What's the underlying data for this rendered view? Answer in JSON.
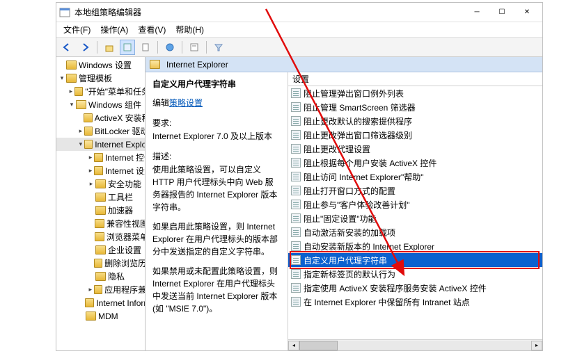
{
  "window": {
    "title": "本地组策略编辑器"
  },
  "menus": [
    "文件(F)",
    "操作(A)",
    "查看(V)",
    "帮助(H)"
  ],
  "tree": [
    {
      "label": "Windows 设置",
      "depth": 0,
      "exp": ""
    },
    {
      "label": "管理模板",
      "depth": 0,
      "exp": "▾"
    },
    {
      "label": "\"开始\"菜单和任务栏",
      "depth": 1,
      "exp": "▸"
    },
    {
      "label": "Windows 组件",
      "depth": 1,
      "exp": "▾",
      "open": true
    },
    {
      "label": "ActiveX 安装程序",
      "depth": 2,
      "exp": ""
    },
    {
      "label": "BitLocker 驱动器",
      "depth": 2,
      "exp": "▸"
    },
    {
      "label": "Internet Explorer",
      "depth": 2,
      "exp": "▾",
      "sel": true,
      "open": true
    },
    {
      "label": "Internet 控件",
      "depth": 3,
      "exp": "▸"
    },
    {
      "label": "Internet 设置",
      "depth": 3,
      "exp": "▸"
    },
    {
      "label": "安全功能",
      "depth": 3,
      "exp": "▸"
    },
    {
      "label": "工具栏",
      "depth": 3,
      "exp": ""
    },
    {
      "label": "加速器",
      "depth": 3,
      "exp": ""
    },
    {
      "label": "兼容性视图",
      "depth": 3,
      "exp": ""
    },
    {
      "label": "浏览器菜单",
      "depth": 3,
      "exp": ""
    },
    {
      "label": "企业设置",
      "depth": 3,
      "exp": ""
    },
    {
      "label": "删除浏览历史",
      "depth": 3,
      "exp": ""
    },
    {
      "label": "隐私",
      "depth": 3,
      "exp": ""
    },
    {
      "label": "应用程序兼容",
      "depth": 3,
      "exp": "▸"
    },
    {
      "label": "Internet Inform",
      "depth": 2,
      "exp": ""
    },
    {
      "label": "MDM",
      "depth": 2,
      "exp": ""
    }
  ],
  "header": {
    "title": "Internet Explorer",
    "col": "设置"
  },
  "details": {
    "title": "自定义用户代理字符串",
    "link_prefix": "编辑",
    "link": "策略设置",
    "req_label": "要求:",
    "req": "Internet Explorer 7.0 及以上版本",
    "desc_label": "描述:",
    "p1": "使用此策略设置，可以自定义 HTTP 用户代理标头中向 Web 服务器报告的 Internet Explorer 版本字符串。",
    "p2": "如果启用此策略设置，则 Internet Explorer 在用户代理标头的版本部分中发送指定的自定义字符串。",
    "p3": "如果禁用或未配置此策略设置，则 Internet Explorer 在用户代理标头中发送当前 Internet Explorer 版本(如 \"MSIE 7.0\")。"
  },
  "settings": [
    "阻止管理弹出窗口例外列表",
    "阻止管理 SmartScreen 筛选器",
    "阻止更改默认的搜索提供程序",
    "阻止更改弹出窗口筛选器级别",
    "阻止更改代理设置",
    "阻止根据每个用户安装 ActiveX 控件",
    "阻止访问 Internet Explorer\"帮助\"",
    "阻止打开窗口方式的配置",
    "阻止参与\"客户体验改善计划\"",
    "阻止\"固定设置\"功能",
    "自动激活新安装的加载项",
    "自动安装新版本的 Internet Explorer",
    "自定义用户代理字符串",
    "指定新标签页的默认行为",
    "指定使用 ActiveX 安装程序服务安装 ActiveX 控件",
    "在 Internet Explorer 中保留所有 Intranet 站点"
  ],
  "selected_index": 12
}
